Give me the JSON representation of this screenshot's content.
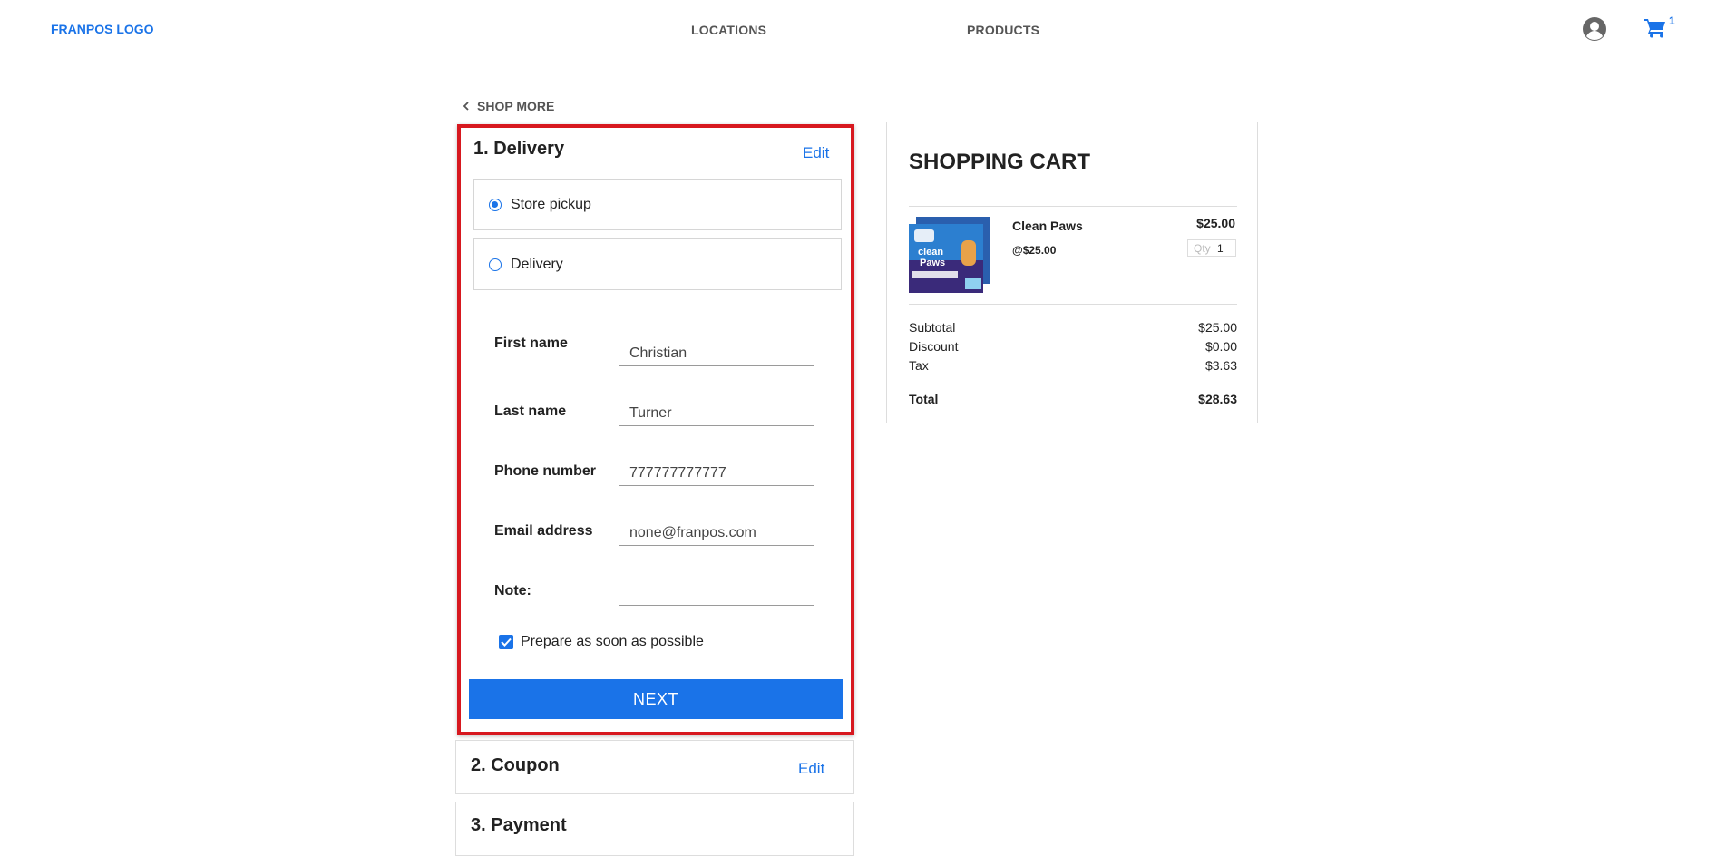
{
  "header": {
    "logo": "FRANPOS LOGO",
    "nav": [
      "LOCATIONS",
      "PRODUCTS"
    ],
    "cart_count": "1"
  },
  "shop_more": "SHOP MORE",
  "delivery": {
    "title": "1. Delivery",
    "edit": "Edit",
    "options": [
      {
        "label": "Store pickup",
        "selected": true
      },
      {
        "label": "Delivery",
        "selected": false
      }
    ],
    "fields": [
      {
        "label": "First name",
        "value": "Christian"
      },
      {
        "label": "Last name",
        "value": "Turner"
      },
      {
        "label": "Phone number",
        "value": "777777777777"
      },
      {
        "label": "Email address",
        "value": "none@franpos.com"
      },
      {
        "label": "Note:",
        "value": ""
      }
    ],
    "prepare_label": "Prepare as soon as possible",
    "prepare_checked": true,
    "next_label": "NEXT"
  },
  "coupon": {
    "title": "2. Coupon",
    "edit": "Edit"
  },
  "payment": {
    "title": "3. Payment"
  },
  "cart": {
    "title": "SHOPPING CART",
    "item": {
      "name": "Clean Paws",
      "unit_price": "@$25.00",
      "price": "$25.00",
      "qty_label": "Qty",
      "qty": "1"
    },
    "subtotal_label": "Subtotal",
    "subtotal": "$25.00",
    "discount_label": "Discount",
    "discount": "$0.00",
    "tax_label": "Tax",
    "tax": "$3.63",
    "total_label": "Total",
    "total": "$28.63"
  },
  "colors": {
    "accent": "#1a73e8",
    "highlight_border": "#d7181f"
  },
  "icons": [
    "user-icon",
    "cart-icon",
    "chevron-left-icon",
    "check-icon"
  ]
}
